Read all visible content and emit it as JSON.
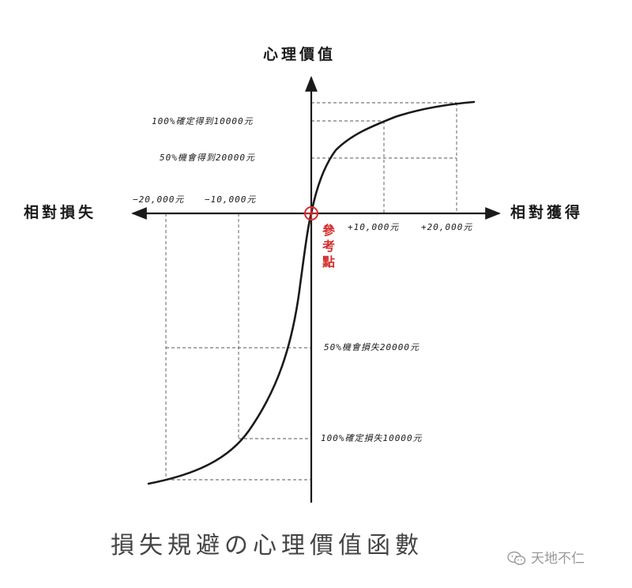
{
  "colors": {
    "ink": "#1a1a1a",
    "accent": "#d42c2c",
    "caption": "#444444",
    "watermark": "#9a9a9a",
    "background": "#ffffff"
  },
  "axes": {
    "y_label": "心理價值",
    "x_right_label": "相對獲得",
    "x_left_label": "相對損失"
  },
  "ticks": {
    "neg20000": "−20,000元",
    "neg10000": "−10,000元",
    "pos10000": "+10,000元",
    "pos20000": "+20,000元"
  },
  "annotations": {
    "gain_certain": "100%確定得到10000元",
    "gain_gamble": "50%機會得到20000元",
    "loss_gamble": "50%機會損失20000元",
    "loss_certain": "100%確定損失10000元"
  },
  "reference_point": {
    "label": "參考點"
  },
  "caption": "損失規避の心理價值函數",
  "watermark": {
    "text": "天地不仁",
    "icon": "wechat-icon"
  }
}
